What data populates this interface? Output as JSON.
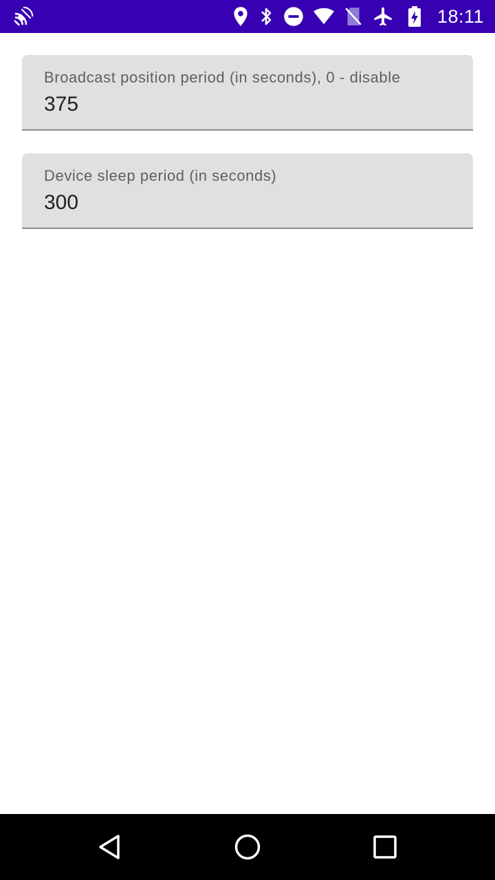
{
  "status_bar": {
    "time": "18:11",
    "icons": [
      "cast-icon",
      "location-icon",
      "bluetooth-icon",
      "do-not-disturb-icon",
      "wifi-icon",
      "no-sim-icon",
      "airplane-mode-icon",
      "battery-charging-icon"
    ],
    "background_color": "#3700b3"
  },
  "settings": {
    "fields": [
      {
        "label": "Broadcast position period (in seconds), 0 - disable",
        "value": "375"
      },
      {
        "label": "Device sleep period (in seconds)",
        "value": "300"
      }
    ]
  },
  "nav_bar": {
    "buttons": [
      "back-icon",
      "home-icon",
      "recents-icon"
    ]
  }
}
